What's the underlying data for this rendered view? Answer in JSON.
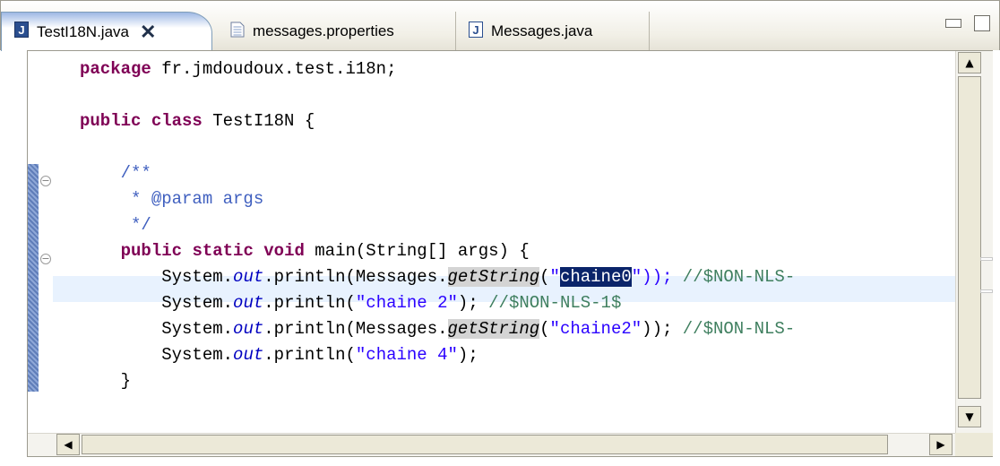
{
  "tabs": [
    {
      "label": "TestI18N.java",
      "icon": "java-file-icon",
      "active": true
    },
    {
      "label": "messages.properties",
      "icon": "properties-file-icon",
      "active": false
    },
    {
      "label": "Messages.java",
      "icon": "java-file-icon",
      "active": false
    }
  ],
  "code": {
    "package_kw": "package",
    "package_name": " fr.jmdoudoux.test.i18n;",
    "public_kw": "public",
    "class_kw": "class",
    "class_name": " TestI18N {",
    "jdoc_open": "/**",
    "jdoc_param": " * @param args",
    "jdoc_close": " */",
    "static_kw": "static",
    "void_kw": "void",
    "main_sig": " main(String[] args) {",
    "sys": "System.",
    "out": "out",
    "println": ".println(",
    "messages": "Messages.",
    "get_string": "getString",
    "open_paren": "(",
    "quote": "\"",
    "chaine0": "chaine0",
    "close_q1": "\")); ",
    "nls_cut": "//$NON-NLS-",
    "chaine2_str": "\"chaine 2\"",
    "close2": "); ",
    "nls1": "//$NON-NLS-1$",
    "chaine2_key": "\"chaine2\"",
    "close3": ")); ",
    "chaine4_str": "\"chaine 4\"",
    "close4": ");",
    "brace": "}"
  },
  "colors": {
    "keyword": "#7f0055",
    "string": "#2a00ff",
    "comment": "#3f7f5f",
    "javadoc": "#3f5fbf",
    "field": "#0000c0",
    "selection": "#0a246a",
    "current_line": "#e8f2fe"
  }
}
